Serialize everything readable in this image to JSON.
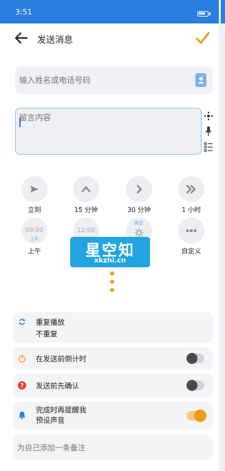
{
  "status_bar": {
    "time": "3:51"
  },
  "header": {
    "title": "发送消息"
  },
  "recipient": {
    "placeholder": "输入姓名或电话号码"
  },
  "message": {
    "placeholder": "留言内容"
  },
  "quick_times": [
    {
      "label": "立刻"
    },
    {
      "label": "15 分钟"
    },
    {
      "label": "30 分钟"
    },
    {
      "label": "1 小时"
    },
    {
      "label": "上午",
      "time": "09:00",
      "sub": "上午"
    },
    {
      "label": "",
      "time": "12:00"
    },
    {
      "label": "",
      "top": "周五"
    },
    {
      "label": "自定义"
    }
  ],
  "watermark": {
    "title": "星空知",
    "url": "xkzhi.cn"
  },
  "repeat": {
    "title": "重复播放",
    "value": "不重复"
  },
  "countdown": {
    "label": "在发送前倒计时",
    "enabled": false
  },
  "confirm": {
    "label": "发送前先确认",
    "enabled": false
  },
  "remind": {
    "line1": "完成时再提醒我",
    "line2": "预设声音",
    "enabled": true
  },
  "note": {
    "placeholder": "为自己添加一条备注"
  },
  "colors": {
    "accent": "#f39a18",
    "primary": "#2a7de1"
  }
}
